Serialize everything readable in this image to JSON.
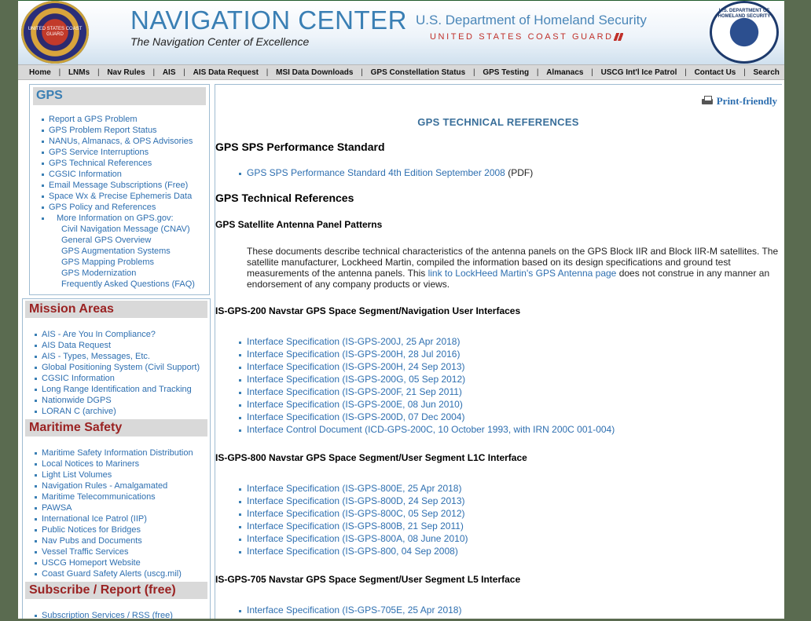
{
  "header": {
    "title": "NAVIGATION CENTER",
    "tagline": "The Navigation Center of Excellence",
    "dhs_name": "U.S. Department of Homeland Security",
    "uscg_name": "UNITED STATES COAST GUARD",
    "uscg_seal_text": "UNITED STATES COAST GUARD",
    "dhs_seal_text": "U.S. DEPARTMENT OF HOMELAND SECURITY"
  },
  "nav": [
    "Home",
    "LNMs",
    "Nav Rules",
    "AIS",
    "AIS Data Request",
    "MSI Data Downloads",
    "GPS Constellation Status",
    "GPS Testing",
    "Almanacs",
    "USCG Int'l Ice Patrol",
    "Contact Us",
    "Search"
  ],
  "sidebar": {
    "gps": {
      "title": "GPS",
      "items": [
        "Report a GPS Problem",
        "GPS Problem Report Status",
        "NANUs, Almanacs, & OPS Advisories",
        "GPS Service Interruptions",
        "GPS Technical References",
        "CGSIC Information",
        "Email Message Subscriptions (Free)",
        "Space Wx & Precise Ephemeris Data",
        "GPS Policy and References"
      ],
      "more_label": "More Information on GPS.gov:",
      "sub_items": [
        "Civil Navigation Message (CNAV)",
        "General GPS Overview",
        "GPS Augmentation Systems",
        "GPS Mapping Problems",
        "GPS Modernization",
        "Frequently Asked Questions (FAQ)"
      ]
    },
    "mission": {
      "title": "Mission Areas",
      "items": [
        "AIS - Are You In Compliance?",
        "AIS Data Request",
        "AIS - Types, Messages, Etc.",
        "Global Positioning System (Civil Support)",
        "CGSIC Information",
        "Long Range Identification and Tracking",
        "Nationwide DGPS",
        "LORAN C (archive)"
      ]
    },
    "maritime": {
      "title": "Maritime Safety",
      "items": [
        "Maritime Safety Information Distribution",
        "Local Notices to Mariners",
        "Light List Volumes",
        "Navigation Rules - Amalgamated",
        "Maritime Telecommunications",
        "PAWSA",
        "International Ice Patrol (IIP)",
        "Public Notices for Bridges",
        "Nav Pubs and Documents",
        "Vessel Traffic Services",
        "USCG Homeport Website",
        "Coast Guard Safety Alerts (uscg.mil)"
      ]
    },
    "subscribe": {
      "title": "Subscribe / Report (free)",
      "items": [
        "Subscription Services / RSS (free)"
      ]
    }
  },
  "main": {
    "print_label": "Print-friendly",
    "heading": "GPS TECHNICAL REFERENCES",
    "sps_title": "GPS SPS Performance Standard",
    "sps_link": "GPS SPS Performance Standard 4th Edition September 2008",
    "sps_suffix": " (PDF)",
    "tech_title": "GPS Technical References",
    "antenna_title": "GPS Satellite Antenna Panel Patterns",
    "antenna_text_1": "These documents describe technical characteristics of the antenna panels on the GPS Block IIR and Block IIR-M satellites. The satellite manufacturer, Lockheed Martin, compiled the information based on its design specifications and ground test measurements of the antenna panels. This ",
    "antenna_link": "link to LockHeed Martin's GPS Antenna page",
    "antenna_text_2": " does not construe in any manner an endorsement of any company products or views.",
    "is200_title": "IS-GPS-200 Navstar GPS Space Segment/Navigation User Interfaces",
    "is200_links": [
      "Interface Specification (IS-GPS-200J, 25 Apr 2018)",
      "Interface Specification (IS-GPS-200H, 28 Jul 2016)",
      "Interface Specification (IS-GPS-200H, 24 Sep 2013)",
      "Interface Specification (IS-GPS-200G, 05 Sep 2012)",
      "Interface Specification (IS-GPS-200F, 21 Sep 2011)",
      "Interface Specification (IS-GPS-200E, 08 Jun 2010)",
      "Interface Specification (IS-GPS-200D, 07 Dec 2004)",
      "Interface Control Document (ICD-GPS-200C, 10 October 1993, with IRN 200C 001-004)"
    ],
    "is800_title": "IS-GPS-800 Navstar GPS Space Segment/User Segment L1C Interface",
    "is800_links": [
      "Interface Specification (IS-GPS-800E, 25 Apr 2018)",
      "Interface Specification (IS-GPS-800D, 24 Sep 2013)",
      "Interface Specification (IS-GPS-800C, 05 Sep 2012)",
      "Interface Specification (IS-GPS-800B, 21 Sep 2011)",
      "Interface Specification (IS-GPS-800A, 08 June 2010)",
      "Interface Specification (IS-GPS-800, 04 Sep 2008)"
    ],
    "is705_title": "IS-GPS-705 Navstar GPS Space Segment/User Segment L5 Interface",
    "is705_links": [
      "Interface Specification (IS-GPS-705E, 25 Apr 2018)"
    ]
  },
  "colors": {
    "title_blue": "#3a7fb4",
    "link_blue": "#2e6fb0",
    "section_red": "#9a2222",
    "nav_gray": "#d8d8d8",
    "page_bg": "#5a6b50"
  }
}
